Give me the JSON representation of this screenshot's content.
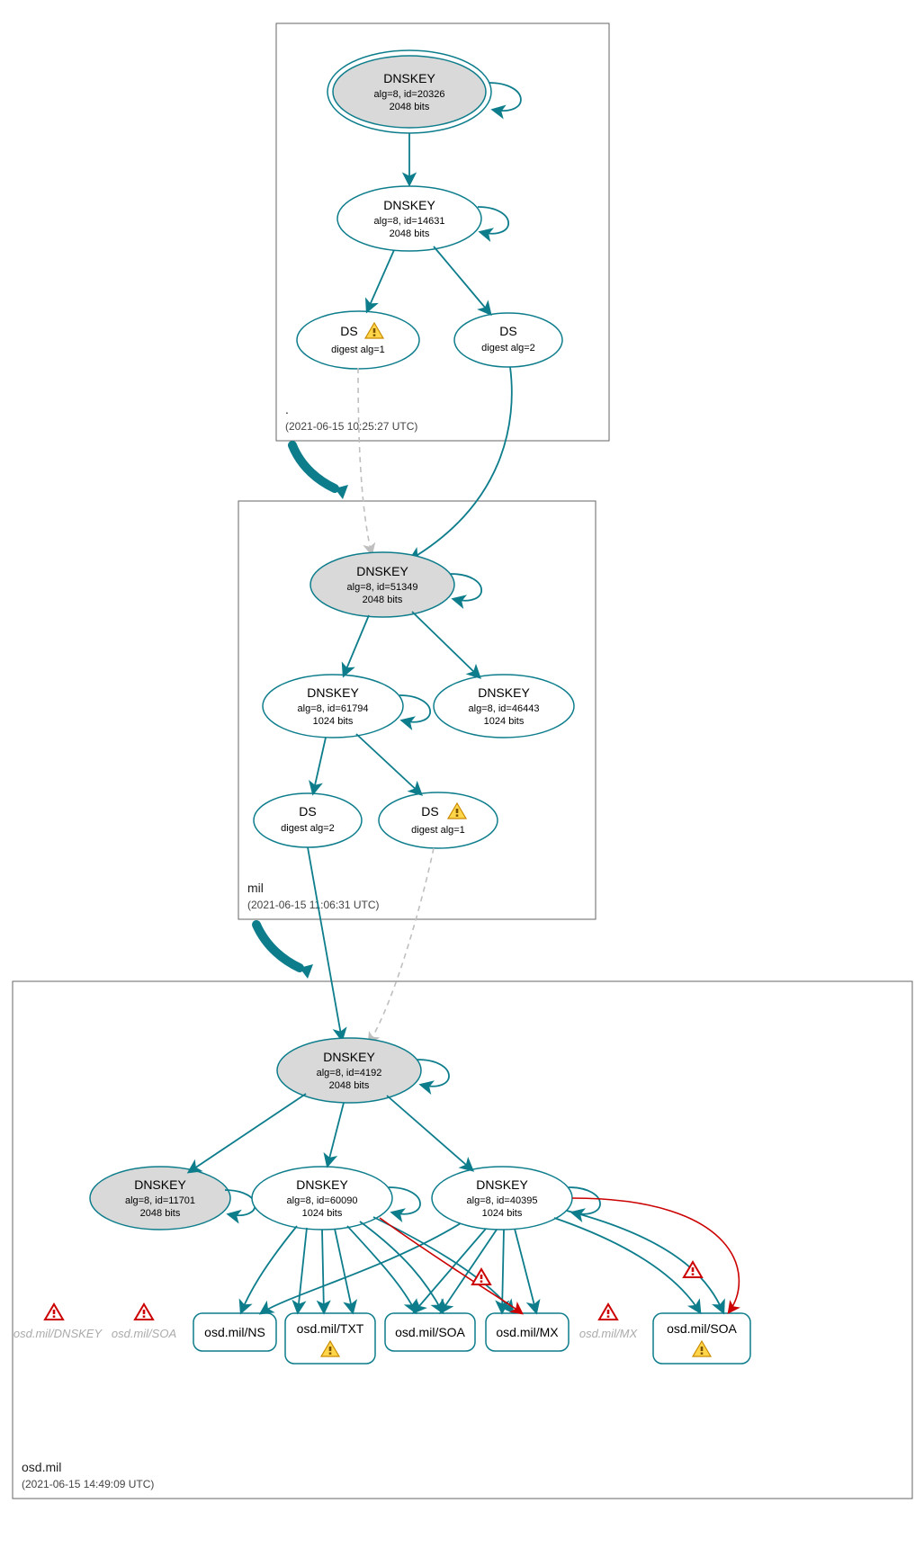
{
  "colors": {
    "accent": "#0d7d8c",
    "error": "#cc0000",
    "ghost": "#aaaaaa",
    "grey_fill": "#d9d9d9"
  },
  "zones": {
    "root": {
      "name": ".",
      "timestamp": "(2021-06-15 10:25:27 UTC)"
    },
    "mil": {
      "name": "mil",
      "timestamp": "(2021-06-15 11:06:31 UTC)"
    },
    "osd": {
      "name": "osd.mil",
      "timestamp": "(2021-06-15 14:49:09 UTC)"
    }
  },
  "nodes": {
    "root_ksk": {
      "title": "DNSKEY",
      "sub1": "alg=8, id=20326",
      "sub2": "2048 bits"
    },
    "root_zsk": {
      "title": "DNSKEY",
      "sub1": "alg=8, id=14631",
      "sub2": "2048 bits"
    },
    "root_ds1": {
      "title": "DS",
      "sub1": "digest alg=1"
    },
    "root_ds2": {
      "title": "DS",
      "sub1": "digest alg=2"
    },
    "mil_ksk": {
      "title": "DNSKEY",
      "sub1": "alg=8, id=51349",
      "sub2": "2048 bits"
    },
    "mil_zsk1": {
      "title": "DNSKEY",
      "sub1": "alg=8, id=61794",
      "sub2": "1024 bits"
    },
    "mil_zsk2": {
      "title": "DNSKEY",
      "sub1": "alg=8, id=46443",
      "sub2": "1024 bits"
    },
    "mil_ds2": {
      "title": "DS",
      "sub1": "digest alg=2"
    },
    "mil_ds1": {
      "title": "DS",
      "sub1": "digest alg=1"
    },
    "osd_ksk": {
      "title": "DNSKEY",
      "sub1": "alg=8, id=4192",
      "sub2": "2048 bits"
    },
    "osd_zsk0": {
      "title": "DNSKEY",
      "sub1": "alg=8, id=11701",
      "sub2": "2048 bits"
    },
    "osd_zsk1": {
      "title": "DNSKEY",
      "sub1": "alg=8, id=60090",
      "sub2": "1024 bits"
    },
    "osd_zsk2": {
      "title": "DNSKEY",
      "sub1": "alg=8, id=40395",
      "sub2": "1024 bits"
    }
  },
  "rrsets": {
    "ghost_dnskey": "osd.mil/DNSKEY",
    "ghost_soa1": "osd.mil/SOA",
    "ns": "osd.mil/NS",
    "txt": "osd.mil/TXT",
    "soa": "osd.mil/SOA",
    "mx": "osd.mil/MX",
    "ghost_mx": "osd.mil/MX",
    "soa2": "osd.mil/SOA"
  },
  "warning_glyph": "⚠",
  "error_glyph": "⚠"
}
